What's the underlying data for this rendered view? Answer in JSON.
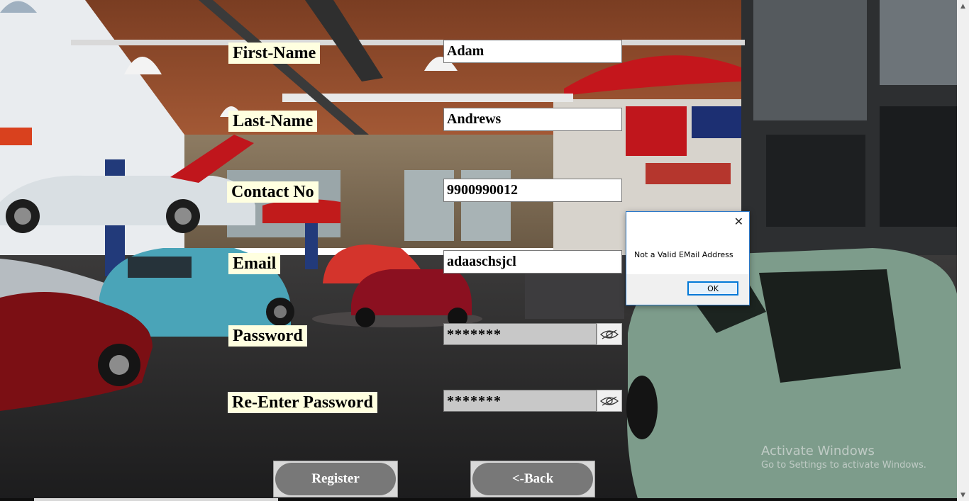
{
  "labels": {
    "first_name": "First-Name",
    "last_name": "Last-Name",
    "contact": "Contact No",
    "email": "Email",
    "password": "Password",
    "reenter": "Re-Enter Password"
  },
  "fields": {
    "first_name": "Adam",
    "last_name": "Andrews",
    "contact": "9900990012",
    "email": "adaaschsjcl",
    "password": "*******",
    "reenter": "*******"
  },
  "buttons": {
    "register": "Register",
    "back": "<-Back"
  },
  "dialog": {
    "message": "Not a Valid EMail Address",
    "ok": "OK",
    "close": "✕"
  },
  "watermark": {
    "line1": "Activate Windows",
    "line2": "Go to Settings to activate Windows."
  },
  "icons": {
    "password_toggle": "eye-icon",
    "reenter_toggle": "eye-icon"
  },
  "colors": {
    "label_bg": "#ffffe0",
    "button_pill": "#787878",
    "dialog_border": "#2b78c8"
  }
}
